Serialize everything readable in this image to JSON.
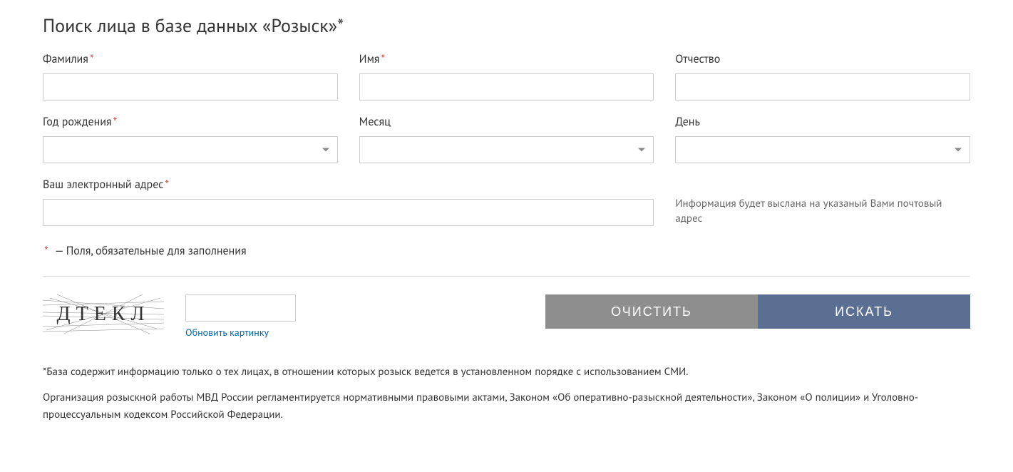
{
  "title": "Поиск лица в базе данных «Розыск»*",
  "fields": {
    "lastname": {
      "label": "Фамилия",
      "required": true
    },
    "firstname": {
      "label": "Имя",
      "required": true
    },
    "patronymic": {
      "label": "Отчество",
      "required": false
    },
    "birth_year": {
      "label": "Год рождения",
      "required": true
    },
    "birth_month": {
      "label": "Месяц",
      "required": false
    },
    "birth_day": {
      "label": "День",
      "required": false
    },
    "email": {
      "label": "Ваш электронный адрес",
      "required": true
    }
  },
  "email_info": "Информация будет выслана на указаный Вами почтовый адрес",
  "legend_text": " — Поля, обязательные для заполнения",
  "captcha": {
    "letters": "ДТЕКЛ",
    "refresh_label": "Обновить картинку"
  },
  "buttons": {
    "clear": "ОЧИСТИТЬ",
    "search": "ИСКАТЬ"
  },
  "footnotes": [
    "*База содержит информацию только о тех лицах, в отношении которых розыск ведется в установленном порядке с использованием СМИ.",
    "Организация розыскной работы МВД России регламентируется нормативными правовыми актами, Законом «Об оперативно-разыскной деятельности», Законом «О полиции» и Уголовно-процессуальным кодексом Российской Федерации."
  ]
}
